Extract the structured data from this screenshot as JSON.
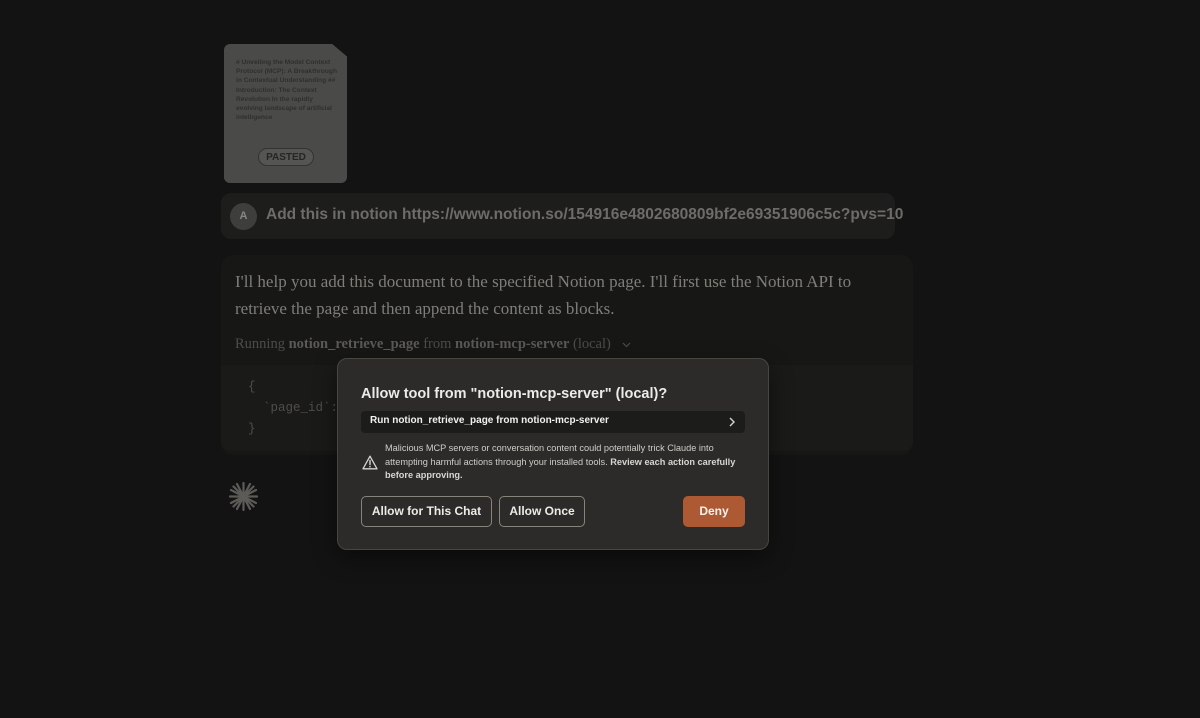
{
  "attachment": {
    "preview_text": "# Unveiling the Model Context Protocol (MCP): A Breakthrough in Contextual Understanding ## Introduction: The Context Revolution In the rapidly evolving landscape of artificial intelligence",
    "badge": "PASTED"
  },
  "user_message": {
    "avatar_initial": "A",
    "text": "Add this in notion https://www.notion.so/154916e4802680809bf2e69351906c5c?pvs=10"
  },
  "assistant": {
    "text": "I'll help you add this document to the specified Notion page. I'll first use the Notion API to retrieve the page and then append the content as blocks.",
    "running_prefix": "Running",
    "tool_name": "notion_retrieve_page",
    "from_word": "from",
    "server_name": "notion-mcp-server",
    "server_suffix": "(local)",
    "code_lines": [
      "{",
      "  `page_id`:",
      "}"
    ]
  },
  "dialog": {
    "title": "Allow tool from \"notion-mcp-server\" (local)?",
    "tool_row_label": "Run notion_retrieve_page from notion-mcp-server",
    "warning_text": "Malicious MCP servers or conversation content could potentially trick Claude into attempting harmful actions through your installed tools.",
    "warning_strong": "Review each action carefully before approving.",
    "buttons": {
      "allow_chat": "Allow for This Chat",
      "allow_once": "Allow Once",
      "deny": "Deny"
    }
  },
  "colors": {
    "deny_button": "#ad5a34",
    "dialog_bg": "#2c2b29",
    "page_bg": "#131313"
  }
}
